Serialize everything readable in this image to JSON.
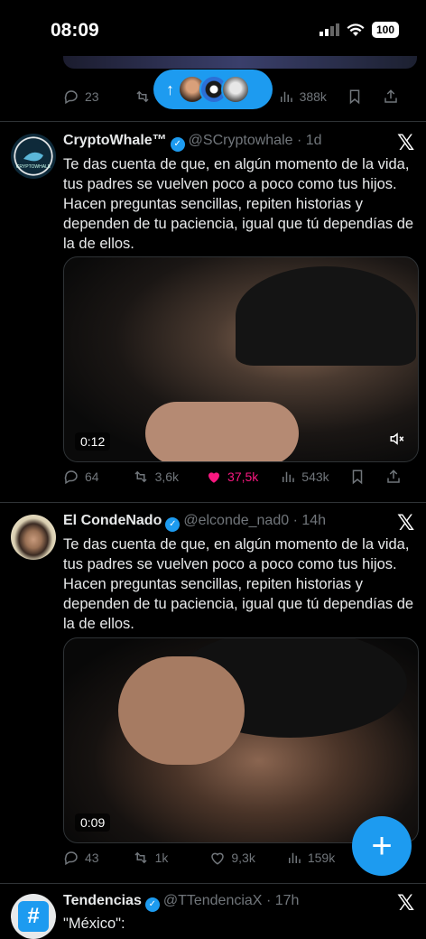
{
  "status": {
    "time": "08:09",
    "battery": "100"
  },
  "top_actions": {
    "replies": "23",
    "views": "388k"
  },
  "tweets": [
    {
      "name": "CryptoWhale™",
      "handle": "@SCryptowhale",
      "time": "· 1d",
      "text": "Te das cuenta de que, en algún momento de la vida, tus padres se vuelven poco a poco como tus hijos. Hacen preguntas sencillas, repiten historias y dependen de tu paciencia, igual que tú dependías de la de ellos.",
      "duration": "0:12",
      "replies": "64",
      "reposts": "3,6k",
      "likes": "37,5k",
      "views": "543k"
    },
    {
      "name": "El CondeNado",
      "handle": "@elconde_nad0",
      "time": "· 14h",
      "text": "Te das cuenta de que, en algún momento de la vida, tus padres se vuelven poco a poco como tus hijos. Hacen preguntas sencillas, repiten historias y dependen de tu paciencia, igual que tú dependías de la de ellos.",
      "duration": "0:09",
      "replies": "43",
      "reposts": "1k",
      "likes": "9,3k",
      "views": "159k"
    },
    {
      "name": "Tendencias",
      "handle": "@TTendenciaX",
      "time": "· 17h",
      "text": "\"México\":"
    }
  ],
  "colors": {
    "accent": "#1d9bf0",
    "like": "#f91880"
  }
}
